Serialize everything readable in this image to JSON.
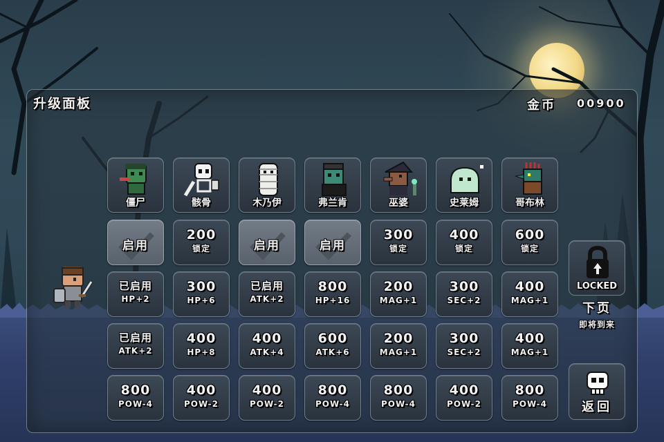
{
  "header": {
    "title": "升级面板",
    "gold_label": "金币",
    "gold_value": "00900"
  },
  "characters": [
    {
      "name": "僵尸",
      "icon": "zombie-icon"
    },
    {
      "name": "骸骨",
      "icon": "skeleton-icon"
    },
    {
      "name": "木乃伊",
      "icon": "mummy-icon"
    },
    {
      "name": "弗兰肯",
      "icon": "frankenstein-icon"
    },
    {
      "name": "巫婆",
      "icon": "witch-icon"
    },
    {
      "name": "史莱姆",
      "icon": "slime-icon"
    },
    {
      "name": "哥布林",
      "icon": "goblin-icon"
    }
  ],
  "unlock_row": [
    {
      "state": "启用",
      "type": "enabled"
    },
    {
      "price": "200",
      "sub": "锁定"
    },
    {
      "state": "启用",
      "type": "enabled"
    },
    {
      "state": "启用",
      "type": "enabled"
    },
    {
      "price": "300",
      "sub": "锁定"
    },
    {
      "price": "400",
      "sub": "锁定"
    },
    {
      "price": "600",
      "sub": "锁定"
    }
  ],
  "upgrade_row_1": [
    {
      "state": "已启用",
      "sub": "HP+2"
    },
    {
      "price": "300",
      "sub": "HP+6"
    },
    {
      "state": "已启用",
      "sub": "ATK+2"
    },
    {
      "price": "800",
      "sub": "HP+16"
    },
    {
      "price": "200",
      "sub": "MAG+1"
    },
    {
      "price": "300",
      "sub": "SEC+2"
    },
    {
      "price": "400",
      "sub": "MAG+1"
    }
  ],
  "upgrade_row_2": [
    {
      "state": "已启用",
      "sub": "ATK+2"
    },
    {
      "price": "400",
      "sub": "HP+8"
    },
    {
      "price": "400",
      "sub": "ATK+4"
    },
    {
      "price": "600",
      "sub": "ATK+6"
    },
    {
      "price": "200",
      "sub": "MAG+1"
    },
    {
      "price": "300",
      "sub": "SEC+2"
    },
    {
      "price": "400",
      "sub": "MAG+1"
    }
  ],
  "upgrade_row_3": [
    {
      "price": "800",
      "sub": "POW-4"
    },
    {
      "price": "400",
      "sub": "POW-2"
    },
    {
      "price": "400",
      "sub": "POW-2"
    },
    {
      "price": "800",
      "sub": "POW-4"
    },
    {
      "price": "800",
      "sub": "POW-4"
    },
    {
      "price": "400",
      "sub": "POW-2"
    },
    {
      "price": "800",
      "sub": "POW-4"
    }
  ],
  "side": {
    "locked_label": "LOCKED",
    "next_page_label": "下页",
    "coming_soon_label": "即将到来",
    "back_label": "返回",
    "lock_icon": "padlock-icon",
    "skull_icon": "skull-icon"
  },
  "colors": {
    "panel_border": "#6f7f8c",
    "enabled_cell": "#737c86",
    "moon": "#f2d987",
    "ground": "#2f3f6a"
  }
}
